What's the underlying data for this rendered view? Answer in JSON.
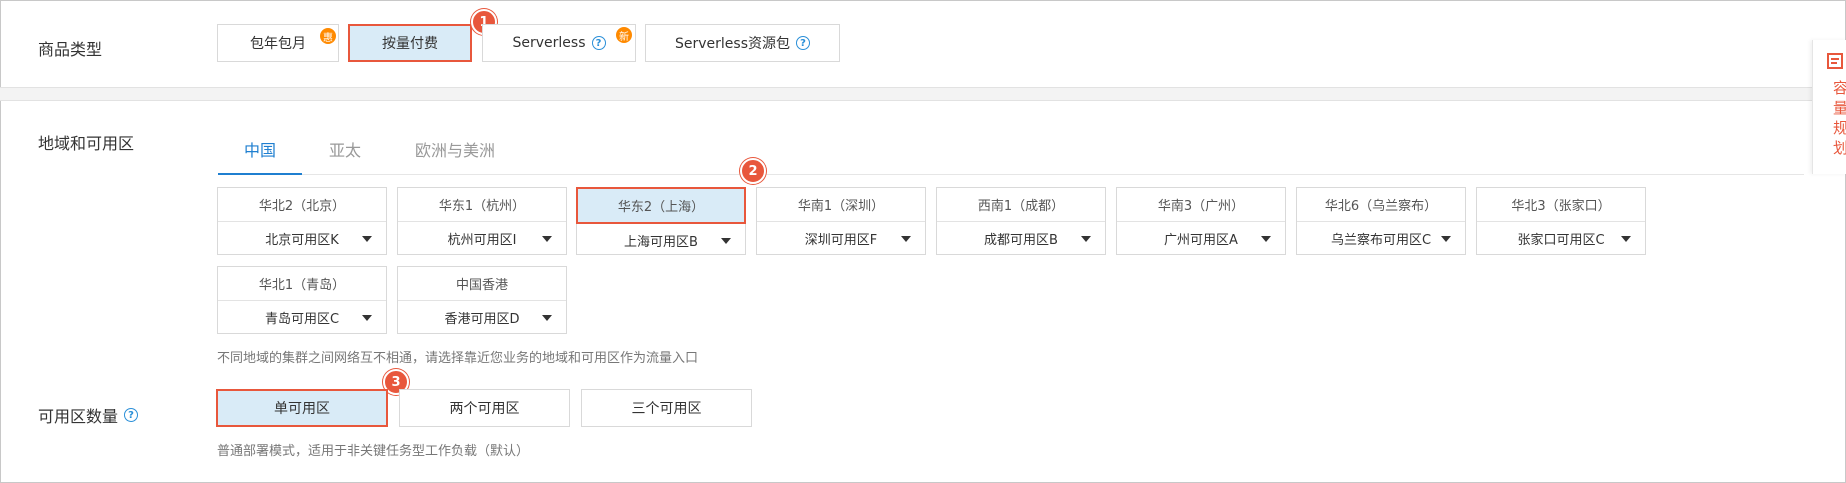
{
  "product_type": {
    "label": "商品类型",
    "options": [
      {
        "label": "包年包月",
        "badge": "惠",
        "selected": false
      },
      {
        "label": "按量付费",
        "selected": true,
        "step": "1"
      },
      {
        "label": "Serverless",
        "help": "?",
        "badge": "新",
        "selected": false
      },
      {
        "label": "Serverless资源包",
        "help": "?",
        "selected": false
      }
    ]
  },
  "region_zone": {
    "label": "地域和可用区",
    "tabs": [
      {
        "label": "中国",
        "active": true
      },
      {
        "label": "亚太",
        "active": false
      },
      {
        "label": "欧洲与美洲",
        "active": false
      }
    ],
    "step": "2",
    "regions": [
      {
        "title": "华北2（北京）",
        "zone": "北京可用区K"
      },
      {
        "title": "华东1（杭州）",
        "zone": "杭州可用区I"
      },
      {
        "title": "华东2（上海）",
        "zone": "上海可用区B",
        "selected": true
      },
      {
        "title": "华南1（深圳）",
        "zone": "深圳可用区F"
      },
      {
        "title": "西南1（成都）",
        "zone": "成都可用区B"
      },
      {
        "title": "华南3（广州）",
        "zone": "广州可用区A"
      },
      {
        "title": "华北6（乌兰察布）",
        "zone": "乌兰察布可用区C"
      },
      {
        "title": "华北3（张家口）",
        "zone": "张家口可用区C"
      },
      {
        "title": "华北1（青岛）",
        "zone": "青岛可用区C"
      },
      {
        "title": "中国香港",
        "zone": "香港可用区D"
      }
    ],
    "hint": "不同地域的集群之间网络互不相通，请选择靠近您业务的地域和可用区作为流量入口"
  },
  "zone_count": {
    "label": "可用区数量",
    "help": "?",
    "step": "3",
    "options": [
      {
        "label": "单可用区",
        "selected": true
      },
      {
        "label": "两个可用区",
        "selected": false
      },
      {
        "label": "三个可用区",
        "selected": false
      }
    ],
    "hint": "普通部署模式，适用于非关键任务型工作负载（默认）"
  },
  "side_panel": {
    "icon": "capacity-planning-icon",
    "text": "容量规划"
  },
  "colors": {
    "accent": "#1f7fd0",
    "highlight_border": "#e8573c",
    "selected_bg": "#d9ebf7",
    "badge": "#ff8a00"
  }
}
